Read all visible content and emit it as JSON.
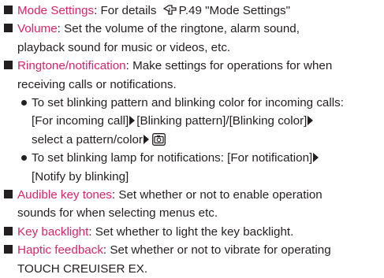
{
  "items": [
    {
      "term": "Mode Settings",
      "desc_before": ": For details ",
      "ref_icon": "reference-pointer-icon",
      "desc_after": "P.49 \"Mode Settings\""
    },
    {
      "term": "Volume",
      "line1": ": Set the volume of the ringtone, alarm sound,",
      "line2": "playback sound for music or videos, etc."
    },
    {
      "term": "Ringtone/notification",
      "line1": ": Make settings for operations for when",
      "line2": "receiving calls or notifications.",
      "subs": [
        {
          "line1": "To set blinking pattern and blinking color for incoming calls:",
          "l2_a": "[For incoming call]",
          "l2_b": "[Blinking pattern]/[Blinking color]",
          "l3_a": "select a pattern/color",
          "icon": "camera-key-icon"
        },
        {
          "l1_a": "To set blinking lamp for notifications: [For notification]",
          "line2": "[Notify by blinking]"
        }
      ]
    },
    {
      "term": "Audible key tones",
      "line1": ": Set whether or not to enable operation",
      "line2": "sounds for when selecting menus etc."
    },
    {
      "term": "Key backlight",
      "line1": ": Set whether to light the key backlight."
    },
    {
      "term": "Haptic feedback",
      "line1": ": Set whether or not to vibrate for operating",
      "line2": "TOUCH CREUISER EX."
    }
  ],
  "colors": {
    "term": "#d6246e",
    "text": "#231f20"
  }
}
